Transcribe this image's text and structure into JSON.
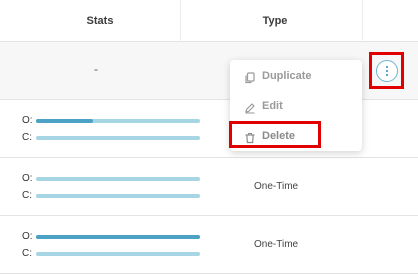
{
  "header": {
    "stats_label": "Stats",
    "type_label": "Type"
  },
  "rows": [
    {
      "stats_placeholder": "-"
    },
    {
      "open_label": "O:",
      "click_label": "C:",
      "open_fraction": 0.35,
      "click_fraction": 0.0,
      "type": ""
    },
    {
      "open_label": "O:",
      "click_label": "C:",
      "open_fraction": 0.0,
      "click_fraction": 0.0,
      "type": "One-Time"
    },
    {
      "open_label": "O:",
      "click_label": "C:",
      "open_fraction": 1.0,
      "click_fraction": 0.0,
      "type": "One-Time"
    }
  ],
  "menu": {
    "items": [
      {
        "label": "Duplicate",
        "icon": "copy-icon"
      },
      {
        "label": "Edit",
        "icon": "pencil-icon"
      },
      {
        "label": "Delete",
        "icon": "trash-icon"
      }
    ]
  },
  "colors": {
    "bar_track": "#a6d6e3",
    "bar_fill": "#4ba2c4",
    "highlight": "#e00000"
  }
}
